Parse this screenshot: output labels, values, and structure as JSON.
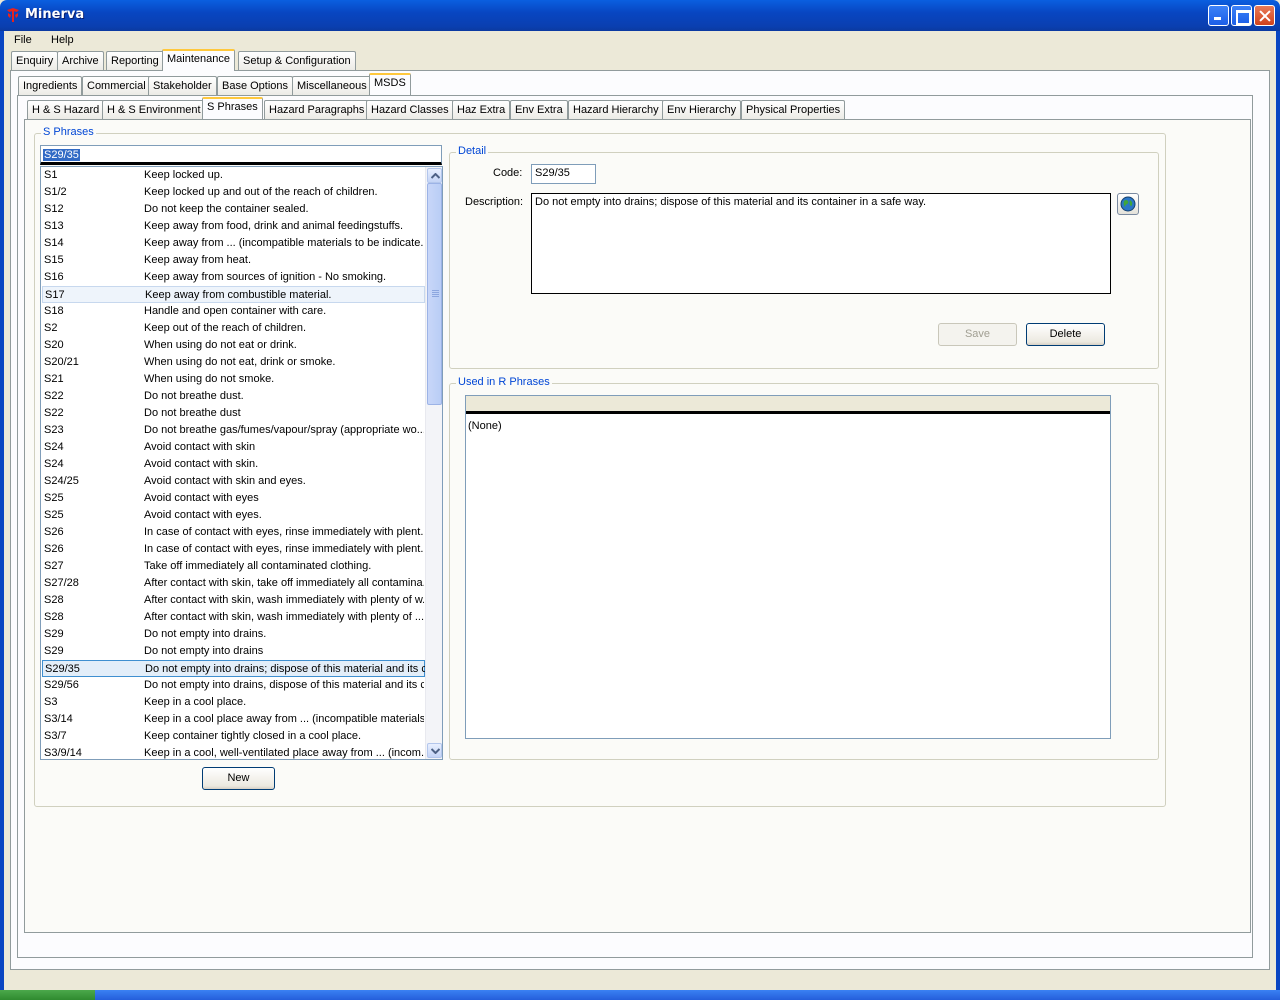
{
  "window": {
    "title": "Minerva"
  },
  "menu": [
    "File",
    "Help"
  ],
  "main_tabs": [
    "Enquiry",
    "Archive",
    "Reporting",
    "Maintenance",
    "Setup & Configuration"
  ],
  "maintenance_tabs": [
    "Ingredients",
    "Commercial",
    "Stakeholder",
    "Base Options",
    "Miscellaneous",
    "MSDS"
  ],
  "msds_tabs": [
    "H & S Hazard",
    "H & S Environment",
    "S Phrases",
    "Hazard Paragraphs",
    "Hazard Classes",
    "Haz Extra",
    "Env Extra",
    "Hazard Hierarchy",
    "Env Hierarchy",
    "Physical Properties"
  ],
  "s_phrases": {
    "group_label": "S Phrases",
    "search_value": "S29/35",
    "rows": [
      {
        "code": "S1",
        "desc": "Keep locked up."
      },
      {
        "code": "S1/2",
        "desc": "Keep locked up and out of the reach of children."
      },
      {
        "code": "S12",
        "desc": "Do not keep the container sealed."
      },
      {
        "code": "S13",
        "desc": "Keep away from food, drink and animal feedingstuffs."
      },
      {
        "code": "S14",
        "desc": "Keep away from ... (incompatible materials to be indicate..."
      },
      {
        "code": "S15",
        "desc": "Keep away from heat."
      },
      {
        "code": "S16",
        "desc": "Keep away from sources of ignition - No smoking."
      },
      {
        "code": "S17",
        "desc": "Keep away from combustible material."
      },
      {
        "code": "S18",
        "desc": "Handle and open container with care."
      },
      {
        "code": "S2",
        "desc": "Keep out of the reach of children."
      },
      {
        "code": "S20",
        "desc": "When using do not eat or drink."
      },
      {
        "code": "S20/21",
        "desc": "When using do not eat, drink or smoke."
      },
      {
        "code": "S21",
        "desc": "When using do not smoke."
      },
      {
        "code": "S22",
        "desc": "Do not breathe dust."
      },
      {
        "code": "S22",
        "desc": "Do not breathe dust"
      },
      {
        "code": "S23",
        "desc": "Do not breathe gas/fumes/vapour/spray (appropriate wo..."
      },
      {
        "code": "S24",
        "desc": "Avoid contact with skin"
      },
      {
        "code": "S24",
        "desc": "Avoid contact with skin."
      },
      {
        "code": "S24/25",
        "desc": "Avoid contact with skin and eyes."
      },
      {
        "code": "S25",
        "desc": "Avoid contact with eyes"
      },
      {
        "code": "S25",
        "desc": "Avoid contact with eyes."
      },
      {
        "code": "S26",
        "desc": "In case of contact with eyes, rinse immediately with plent..."
      },
      {
        "code": "S26",
        "desc": "In case of contact with eyes, rinse immediately with plent..."
      },
      {
        "code": "S27",
        "desc": "Take off immediately all contaminated clothing."
      },
      {
        "code": "S27/28",
        "desc": "After contact with skin, take off immediately all contamina..."
      },
      {
        "code": "S28",
        "desc": "After contact with skin, wash immediately with plenty of w..."
      },
      {
        "code": "S28",
        "desc": "After contact with skin, wash immediately with plenty of ...."
      },
      {
        "code": "S29",
        "desc": "Do not empty into drains."
      },
      {
        "code": "S29",
        "desc": "Do not empty into drains"
      },
      {
        "code": "S29/35",
        "desc": "Do not empty into drains; dispose of this material and its c..."
      },
      {
        "code": "S29/56",
        "desc": "Do not empty into drains, dispose of this material and its c..."
      },
      {
        "code": "S3",
        "desc": "Keep in a cool place."
      },
      {
        "code": "S3/14",
        "desc": "Keep in a cool place away from ... (incompatible materials..."
      },
      {
        "code": "S3/7",
        "desc": "Keep container tightly closed in a cool place."
      },
      {
        "code": "S3/9/14",
        "desc": "Keep in a cool, well-ventilated place away from ... (incom..."
      }
    ],
    "new_label": "New"
  },
  "detail": {
    "group_label": "Detail",
    "code_label": "Code:",
    "code_value": "S29/35",
    "description_label": "Description:",
    "description_value": "Do not empty into drains; dispose of this material and its container in a safe way.",
    "save_label": "Save",
    "delete_label": "Delete"
  },
  "used_in": {
    "group_label": "Used in R Phrases",
    "empty_text": "(None)"
  }
}
